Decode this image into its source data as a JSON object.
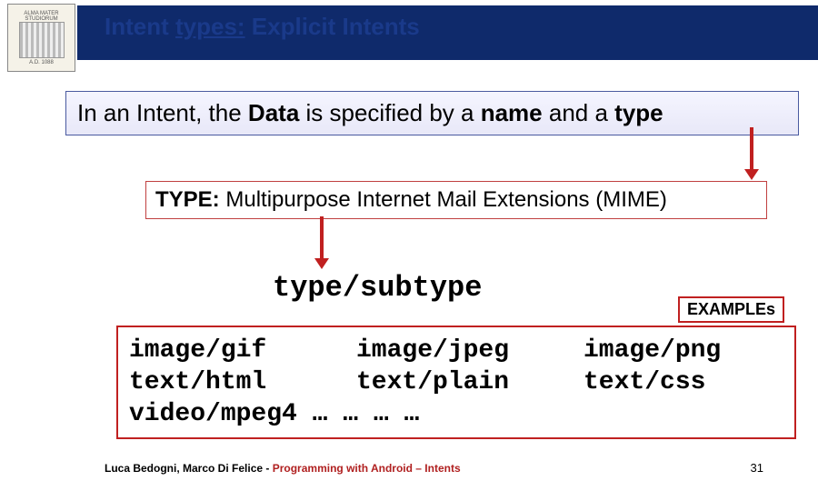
{
  "header": {
    "title_plain_1": "Intent ",
    "title_underline_1": "types:",
    "title_plain_2": " Explicit Intents"
  },
  "logo": {
    "top_text": "ALMA MATER STUDIORUM",
    "bottom_text": "A.D. 1088"
  },
  "main_statement": {
    "t1": "In an Intent, the ",
    "t2": "Data",
    "t3": " is specified by a ",
    "t4": "name",
    "t5": " and a ",
    "t6": "type"
  },
  "type_line": {
    "label": "TYPE:",
    "text": "  Multipurpose Internet Mail Extensions (MIME)"
  },
  "type_subtype": "type/subtype",
  "examples_tag": "EXAMPLEs",
  "examples": {
    "r1c1": "image/gif",
    "r1c2": "image/jpeg",
    "r1c3": "image/png",
    "r2c1": "text/html",
    "r2c2": "text/plain",
    "r2c3": "text/css",
    "r3": "video/mpeg4 … … … …"
  },
  "footer": {
    "authors": "Luca Bedogni, Marco Di Felice",
    "dash": " - ",
    "course": "Programming with Android – Intents"
  },
  "page_number": "31"
}
